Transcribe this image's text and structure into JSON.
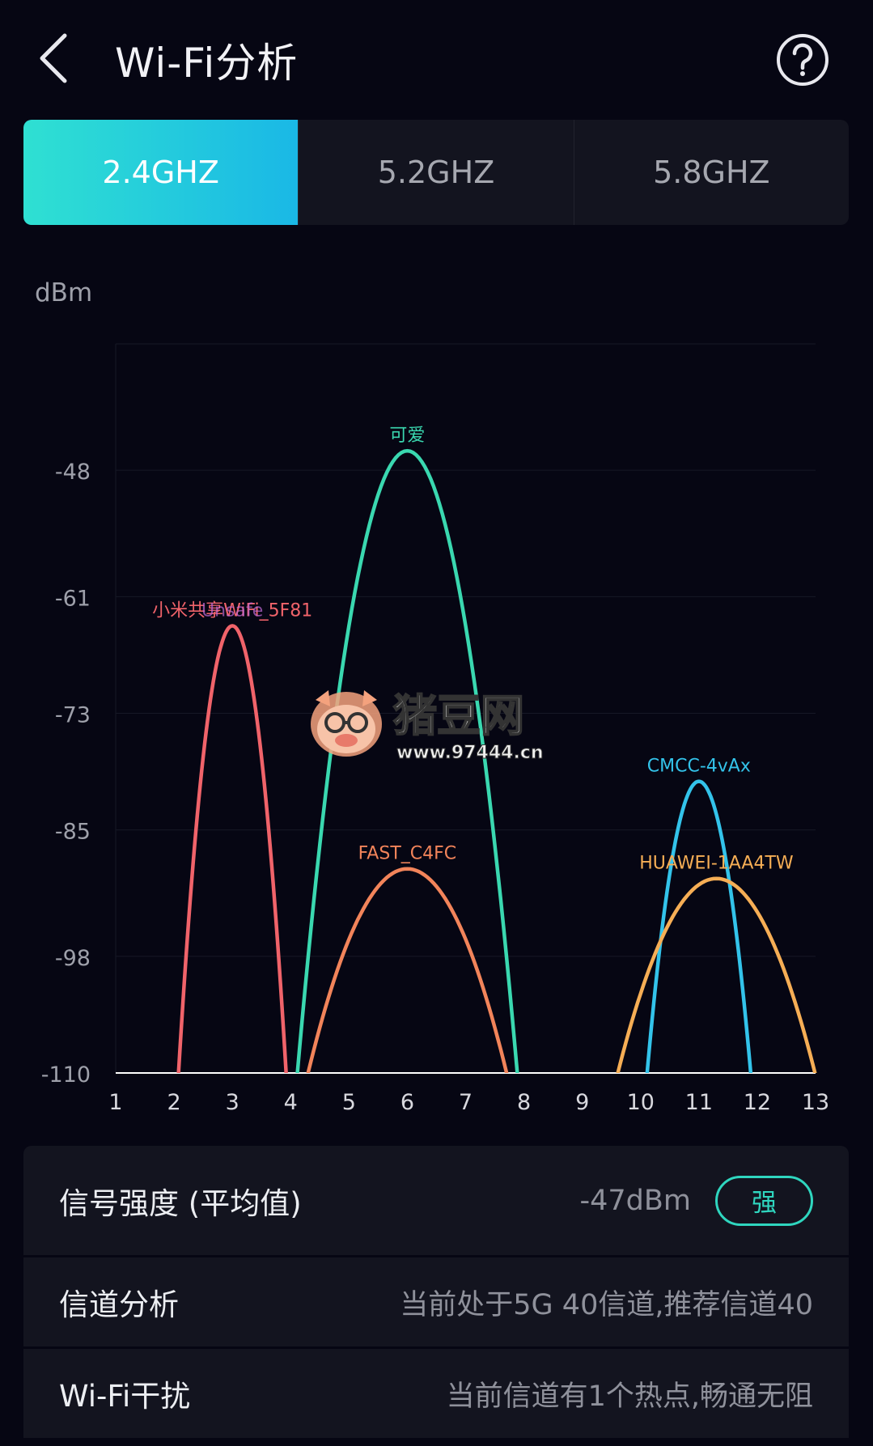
{
  "header": {
    "title": "Wi-Fi分析"
  },
  "tabs": [
    {
      "label": "2.4GHZ",
      "active": true
    },
    {
      "label": "5.2GHZ",
      "active": false
    },
    {
      "label": "5.8GHZ",
      "active": false
    }
  ],
  "chart_data": {
    "type": "line",
    "ylabel": "dBm",
    "y_ticks": [
      "-48",
      "-61",
      "-73",
      "-85",
      "-98",
      "-110"
    ],
    "x_ticks": [
      "1",
      "2",
      "3",
      "4",
      "5",
      "6",
      "7",
      "8",
      "9",
      "10",
      "11",
      "12",
      "13"
    ],
    "ylim": [
      -110,
      -35
    ],
    "xlim": [
      1,
      13
    ],
    "grid": true,
    "series": [
      {
        "name": "小米共享WiFi_5F81",
        "label_overlap": "Unsafe",
        "center_channel": 3,
        "peak_dbm": -64,
        "width": 2,
        "color": "#f0636a"
      },
      {
        "name": "可爱",
        "center_channel": 6,
        "peak_dbm": -46,
        "width": 4,
        "color": "#3ad8b0"
      },
      {
        "name": "FAST_C4FC",
        "center_channel": 6,
        "peak_dbm": -89,
        "width": 4,
        "color": "#f2845a"
      },
      {
        "name": "CMCC-4vAx",
        "center_channel": 11,
        "peak_dbm": -80,
        "width": 2,
        "color": "#33c3ea"
      },
      {
        "name": "HUAWEI-1AA4TW",
        "center_channel": 11.3,
        "peak_dbm": -90,
        "width": 4,
        "color": "#f6ae55"
      }
    ]
  },
  "watermark": {
    "text": "猪豆网",
    "url": "www.97444.cn"
  },
  "info": {
    "signal_label": "信号强度 (平均值)",
    "signal_value": "-47dBm",
    "signal_badge": "强",
    "channel_label": "信道分析",
    "channel_value": "当前处于5G 40信道,推荐信道40",
    "interference_label": "Wi-Fi干扰",
    "interference_value": "当前信道有1个热点,畅通无阻"
  },
  "colors": {
    "accent": "#2fd6bf",
    "background": "#060613",
    "card": "#13141f"
  }
}
